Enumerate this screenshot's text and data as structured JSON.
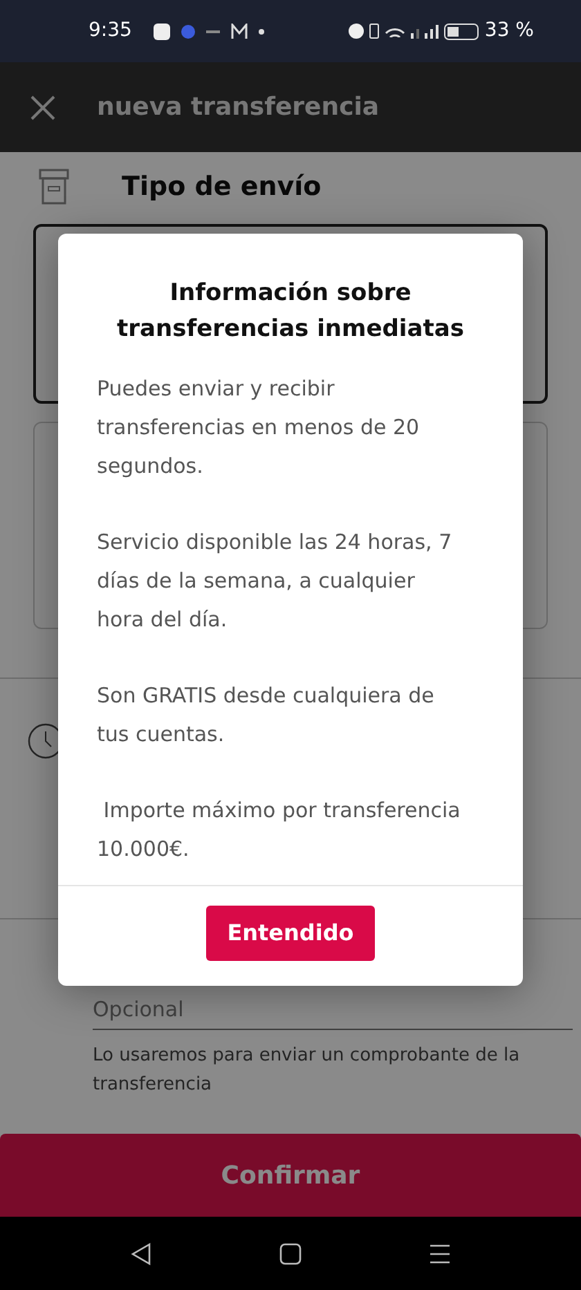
{
  "status_bar": {
    "time": "9:35",
    "battery": "33 %"
  },
  "app_bar": {
    "title": "nueva transferencia"
  },
  "section": {
    "title": "Tipo de envío"
  },
  "email_field": {
    "placeholder": "Opcional",
    "helper": "Lo usaremos para enviar un comprobante de la transferencia"
  },
  "confirm_button": "Confirmar",
  "dialog": {
    "title": "Información sobre transferencias inmediatas",
    "paragraphs": [
      "Puedes enviar y recibir transferencias en menos de 20 segundos.",
      "Servicio disponible las 24 horas, 7 días de la semana, a cualquier hora del día.",
      "Son GRATIS desde cualquiera de tus cuentas.",
      " Importe máximo por transferencia 10.000€."
    ],
    "button": "Entendido"
  }
}
